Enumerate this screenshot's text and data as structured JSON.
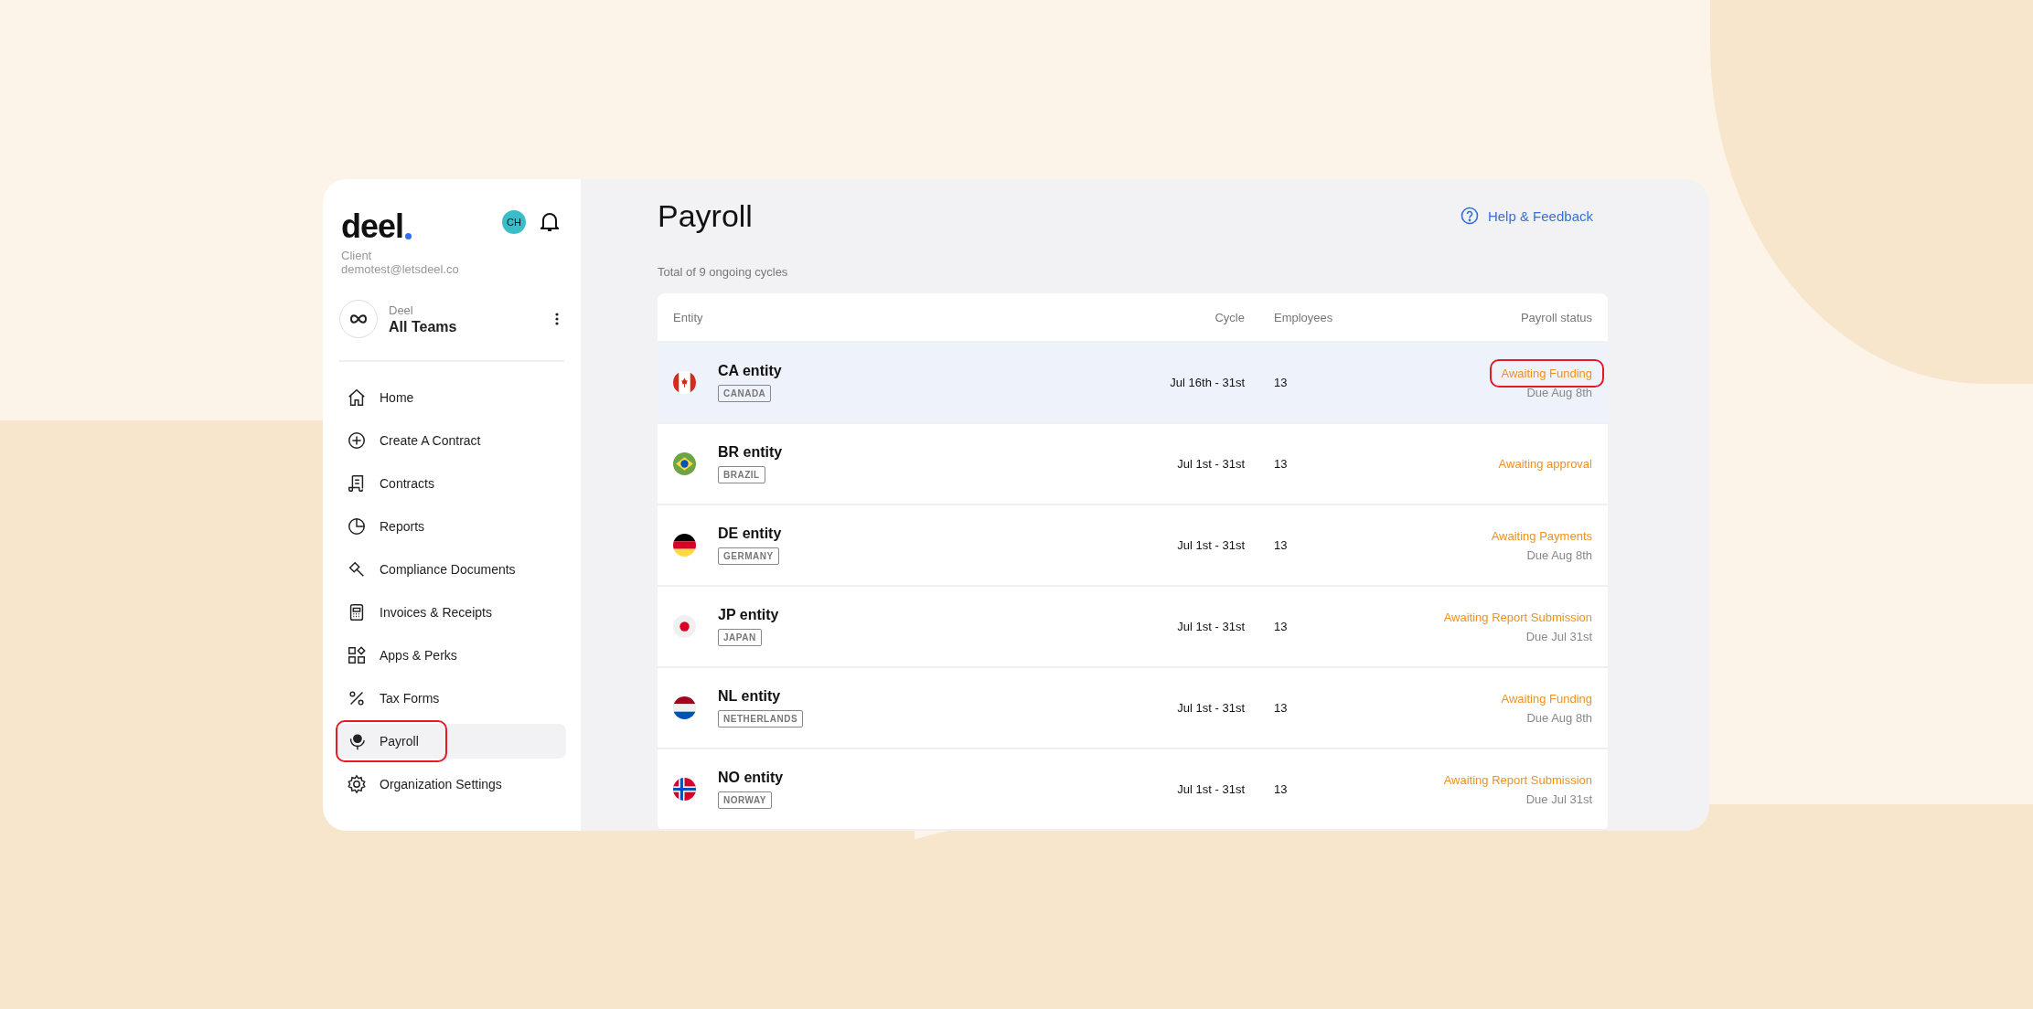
{
  "sidebar": {
    "logo": "deel",
    "role": "Client",
    "email": "demotest@letsdeel.co",
    "avatar": "CH",
    "team": {
      "org": "Deel",
      "name": "All Teams"
    },
    "items": [
      {
        "label": "Home",
        "selected": false,
        "annotated": false
      },
      {
        "label": "Create A Contract",
        "selected": false,
        "annotated": false
      },
      {
        "label": "Contracts",
        "selected": false,
        "annotated": false
      },
      {
        "label": "Reports",
        "selected": false,
        "annotated": false
      },
      {
        "label": "Compliance Documents",
        "selected": false,
        "annotated": false
      },
      {
        "label": "Invoices & Receipts",
        "selected": false,
        "annotated": false
      },
      {
        "label": "Apps & Perks",
        "selected": false,
        "annotated": false
      },
      {
        "label": "Tax Forms",
        "selected": false,
        "annotated": false
      },
      {
        "label": "Payroll",
        "selected": true,
        "annotated": true
      },
      {
        "label": "Organization Settings",
        "selected": false,
        "annotated": false
      }
    ]
  },
  "main": {
    "title": "Payroll",
    "help_link": "Help & Feedback",
    "summary": "Total of 9 ongoing cycles",
    "table": {
      "columns": [
        "Entity",
        "Cycle",
        "Employees",
        "Payroll status"
      ],
      "rows": [
        {
          "entity": "CA entity",
          "country": "CANADA",
          "cycle": "Jul 16th - 31st",
          "employees": "13",
          "status": "Awaiting Funding",
          "due": "Due Aug 8th",
          "selected": true,
          "annotated": true
        },
        {
          "entity": "BR entity",
          "country": "BRAZIL",
          "cycle": "Jul 1st - 31st",
          "employees": "13",
          "status": "Awaiting approval",
          "selected": false,
          "annotated": false
        },
        {
          "entity": "DE entity",
          "country": "GERMANY",
          "cycle": "Jul 1st - 31st",
          "employees": "13",
          "status": "Awaiting Payments",
          "due": "Due Aug 8th",
          "selected": false,
          "annotated": false
        },
        {
          "entity": "JP entity",
          "country": "JAPAN",
          "cycle": "Jul 1st - 31st",
          "employees": "13",
          "status": "Awaiting Report Submission",
          "due": "Due Jul 31st",
          "selected": false,
          "annotated": false
        },
        {
          "entity": "NL entity",
          "country": "NETHERLANDS",
          "cycle": "Jul 1st - 31st",
          "employees": "13",
          "status": "Awaiting Funding",
          "due": "Due Aug 8th",
          "selected": false,
          "annotated": false
        },
        {
          "entity": "NO entity",
          "country": "NORWAY",
          "cycle": "Jul 1st - 31st",
          "employees": "13",
          "status": "Awaiting Report Submission",
          "due": "Due Jul 31st",
          "selected": false,
          "annotated": false
        }
      ]
    }
  }
}
